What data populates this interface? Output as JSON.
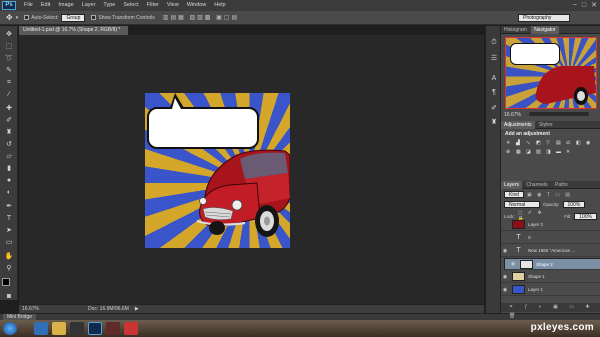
{
  "menubar": {
    "logo": "Ps",
    "items": [
      "File",
      "Edit",
      "Image",
      "Layer",
      "Type",
      "Select",
      "Filter",
      "View",
      "Window",
      "Help"
    ],
    "window_controls": [
      "−",
      "□",
      "✕"
    ]
  },
  "options": {
    "auto_select_label": "Auto-Select:",
    "auto_select_value": "Group",
    "transform_label": "Show Transform Controls",
    "workspace": "Photography"
  },
  "document": {
    "tab_title": "Untitled-1.psd @ 16.7% (Shape 2, RGB/8) *"
  },
  "statusbar": {
    "zoom": "16.67%",
    "doc": "Doc: 16.9M/96.6M"
  },
  "minibridge": {
    "label": "Mini Bridge"
  },
  "navigator": {
    "tabs": [
      "Histogram",
      "Navigator"
    ],
    "zoom": "16.67%"
  },
  "adjustments": {
    "tabs": [
      "Adjustments",
      "Styles"
    ],
    "prompt": "Add an adjustment"
  },
  "layers": {
    "tabs": [
      "Layers",
      "Channels",
      "Paths"
    ],
    "kind": "Kind",
    "blend": "Normal",
    "opacity_label": "Opacity:",
    "opacity": "100%",
    "lock_label": "Lock:",
    "fill_label": "Fill:",
    "fill": "100%",
    "items": [
      {
        "name": "Layer 2",
        "type": "image"
      },
      {
        "name": "rt",
        "type": "text"
      },
      {
        "name": "New 1960 \"American ...",
        "type": "text"
      },
      {
        "name": "Shape 2",
        "type": "shape",
        "selected": true
      },
      {
        "name": "Shape 1",
        "type": "shape"
      },
      {
        "name": "Layer 1",
        "type": "fill"
      }
    ]
  },
  "watermark": {
    "text": "pxleyes.com"
  },
  "colors": {
    "accent": "#4fa3e0",
    "swirl_blue": "#3a55c9",
    "swirl_yellow": "#d4a72a",
    "car_red": "#b3141c"
  }
}
